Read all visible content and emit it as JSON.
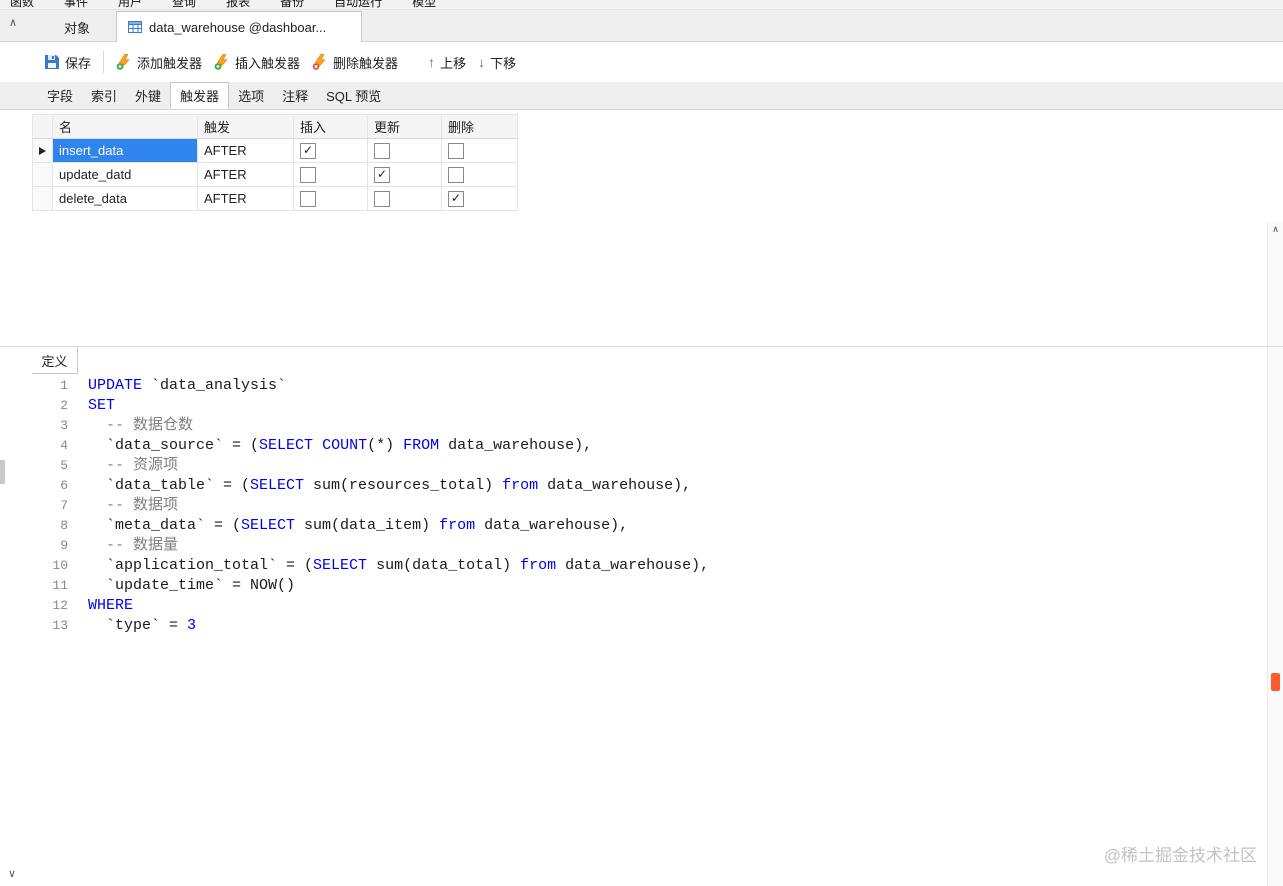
{
  "menu": {
    "items": [
      "函数",
      "事件",
      "用户",
      "查询",
      "报表",
      "备份",
      "自动运行",
      "模型"
    ]
  },
  "tabs": {
    "objects_tab": "对象",
    "active_tab": "data_warehouse @dashboar..."
  },
  "toolbar": {
    "save": "保存",
    "add_trigger": "添加触发器",
    "insert_trigger": "插入触发器",
    "delete_trigger": "删除触发器",
    "move_up": "上移",
    "move_down": "下移",
    "move_up_glyph": "↑",
    "move_down_glyph": "↓"
  },
  "subtabs": {
    "items": [
      "字段",
      "索引",
      "外键",
      "触发器",
      "选项",
      "注释",
      "SQL 预览"
    ],
    "active": "触发器"
  },
  "grid": {
    "columns": [
      "名",
      "触发",
      "插入",
      "更新",
      "删除"
    ],
    "rows": [
      {
        "name": "insert_data",
        "timing": "AFTER",
        "insert": true,
        "update": false,
        "delete": false,
        "selected": true
      },
      {
        "name": "update_datd",
        "timing": "AFTER",
        "insert": false,
        "update": true,
        "delete": false,
        "selected": false
      },
      {
        "name": "delete_data",
        "timing": "AFTER",
        "insert": false,
        "update": false,
        "delete": true,
        "selected": false
      }
    ]
  },
  "definition": {
    "tab": "定义"
  },
  "editor": {
    "lines": [
      {
        "num": "1",
        "segs": [
          {
            "t": "UPDATE",
            "c": "kw"
          },
          {
            "t": " `data_analysis`",
            "c": "pl"
          }
        ]
      },
      {
        "num": "2",
        "segs": [
          {
            "t": "SET",
            "c": "kw"
          }
        ]
      },
      {
        "num": "3",
        "segs": [
          {
            "t": "  -- 数据仓数",
            "c": "cm"
          }
        ]
      },
      {
        "num": "4",
        "segs": [
          {
            "t": "  `data_source` = (",
            "c": "pl"
          },
          {
            "t": "SELECT",
            "c": "kw"
          },
          {
            "t": " ",
            "c": "pl"
          },
          {
            "t": "COUNT",
            "c": "kw"
          },
          {
            "t": "(*) ",
            "c": "pl"
          },
          {
            "t": "FROM",
            "c": "kw"
          },
          {
            "t": " data_warehouse),",
            "c": "pl"
          }
        ]
      },
      {
        "num": "5",
        "segs": [
          {
            "t": "  -- 资源项",
            "c": "cm"
          }
        ]
      },
      {
        "num": "6",
        "segs": [
          {
            "t": "  `data_table` = (",
            "c": "pl"
          },
          {
            "t": "SELECT",
            "c": "kw"
          },
          {
            "t": " sum(resources_total) ",
            "c": "pl"
          },
          {
            "t": "from",
            "c": "kw"
          },
          {
            "t": " data_warehouse),",
            "c": "pl"
          }
        ]
      },
      {
        "num": "7",
        "segs": [
          {
            "t": "  -- 数据项",
            "c": "cm"
          }
        ]
      },
      {
        "num": "8",
        "segs": [
          {
            "t": "  `meta_data` = (",
            "c": "pl"
          },
          {
            "t": "SELECT",
            "c": "kw"
          },
          {
            "t": " sum(data_item) ",
            "c": "pl"
          },
          {
            "t": "from",
            "c": "kw"
          },
          {
            "t": " data_warehouse),",
            "c": "pl"
          }
        ]
      },
      {
        "num": "9",
        "segs": [
          {
            "t": "  -- 数据量",
            "c": "cm"
          }
        ]
      },
      {
        "num": "10",
        "segs": [
          {
            "t": "  `application_total` = (",
            "c": "pl"
          },
          {
            "t": "SELECT",
            "c": "kw"
          },
          {
            "t": " sum(data_total) ",
            "c": "pl"
          },
          {
            "t": "from",
            "c": "kw"
          },
          {
            "t": " data_warehouse),",
            "c": "pl"
          }
        ]
      },
      {
        "num": "11",
        "segs": [
          {
            "t": "  `update_time` = NOW()",
            "c": "pl"
          }
        ]
      },
      {
        "num": "12",
        "segs": [
          {
            "t": "WHERE",
            "c": "kw"
          }
        ]
      },
      {
        "num": "13",
        "segs": [
          {
            "t": "  `type` = ",
            "c": "pl"
          },
          {
            "t": "3",
            "c": "num"
          }
        ]
      }
    ]
  },
  "watermark": "@稀土掘金技术社区",
  "scroll": {
    "up_glyph": "∧",
    "down_glyph": "∨"
  },
  "colors": {
    "selection_blue": "#2f84ed",
    "keyword_blue": "#0000ee",
    "comment_gray": "#808080",
    "marker_orange": "#ff5a2e",
    "icon_orange": "#ffa21f",
    "save_blue": "#3b77c9",
    "tab_icon_blue": "#3a7bd5"
  }
}
